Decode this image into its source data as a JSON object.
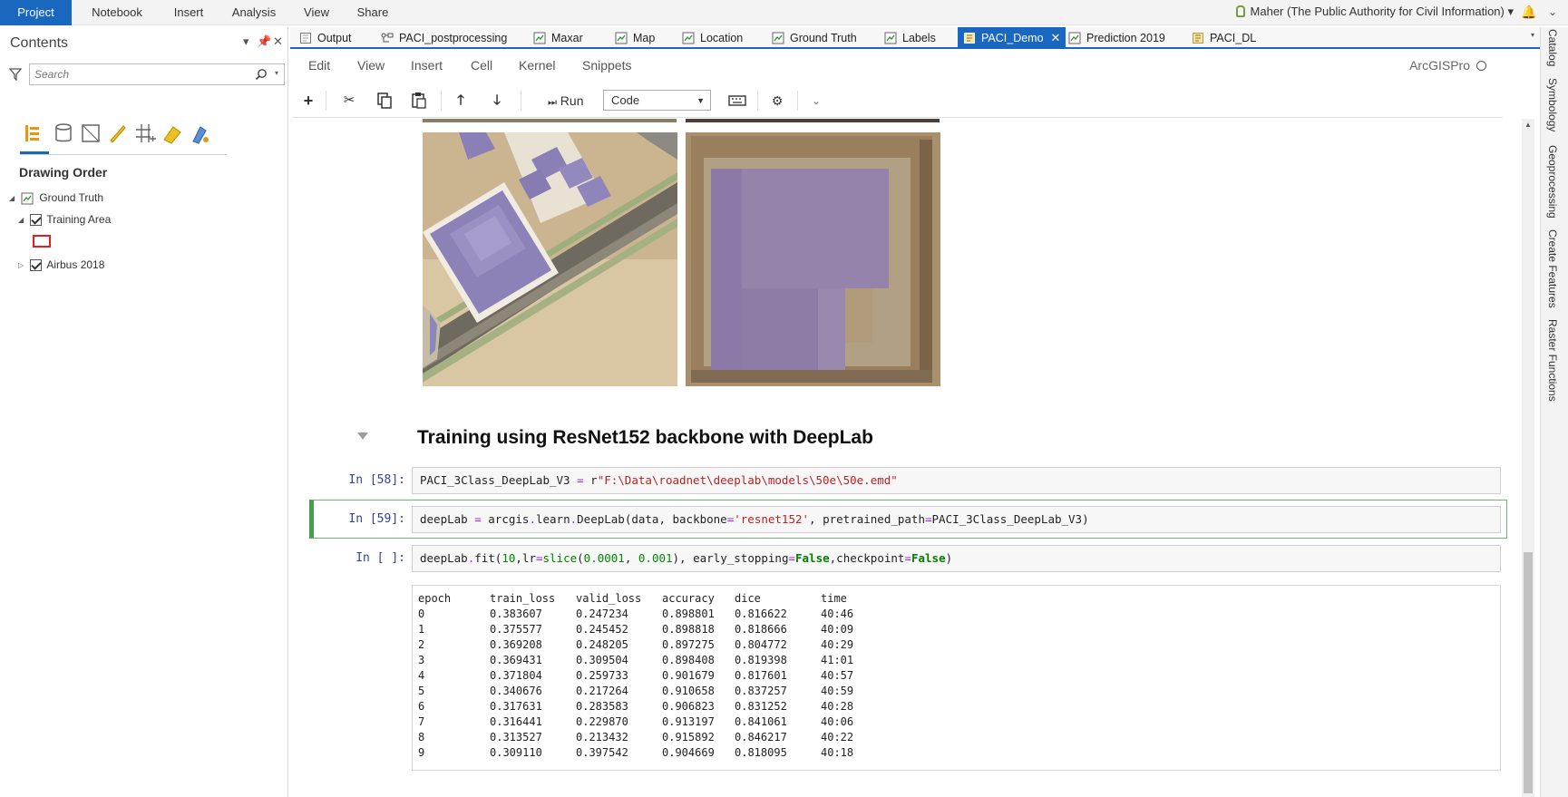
{
  "ribbon": {
    "tabs": [
      "Project",
      "Notebook",
      "Insert",
      "Analysis",
      "View",
      "Share"
    ],
    "user": "Maher (The Public Authority for Civil Information) ▾"
  },
  "contents": {
    "title": "Contents",
    "search_placeholder": "Search",
    "drawing_order": "Drawing Order",
    "tree": {
      "map": "Ground Truth",
      "layer1": "Training Area",
      "layer2": "Airbus 2018"
    }
  },
  "doc_tabs": [
    {
      "label": "Output",
      "icon": "notebook-icon"
    },
    {
      "label": "PACI_postprocessing",
      "icon": "model-icon"
    },
    {
      "label": "Maxar",
      "icon": "map-icon"
    },
    {
      "label": "Map",
      "icon": "map-icon"
    },
    {
      "label": "Location",
      "icon": "map-icon"
    },
    {
      "label": "Ground Truth",
      "icon": "map-icon"
    },
    {
      "label": "Labels",
      "icon": "map-icon"
    },
    {
      "label": "PACI_Demo",
      "icon": "notebook-icon",
      "active": true
    },
    {
      "label": "Prediction 2019",
      "icon": "map-icon"
    },
    {
      "label": "PACI_DL",
      "icon": "notebook-icon"
    }
  ],
  "nb_menu": [
    "Edit",
    "View",
    "Insert",
    "Cell",
    "Kernel",
    "Snippets"
  ],
  "kernel": "ArcGISPro",
  "toolbar": {
    "run": "Run",
    "cell_type": "Code"
  },
  "notebook": {
    "heading": "Training using ResNet152 backbone with DeepLab",
    "cells": [
      {
        "prompt": "In [58]:",
        "code": {
          "a": "PACI_3Class_DeepLab_V3 ",
          "b": "=",
          "c": " r",
          "d": "\"F:\\Data\\roadnet\\deeplab\\models\\50e\\50e.emd\""
        }
      },
      {
        "prompt": "In [59]:",
        "code": {
          "a": "deepLab ",
          "b": "=",
          "c": " arcgis",
          "d": ".",
          "e": "learn",
          "f": ".",
          "g": "DeepLab(data, backbone",
          "h": "=",
          "i": "'resnet152'",
          "j": ", pretrained_path",
          "k": "=",
          "l": "PACI_3Class_DeepLab_V3)"
        }
      },
      {
        "prompt": "In [ ]:",
        "code": {
          "a": "deepLab",
          "b": ".",
          "c": "fit(",
          "d": "10",
          "e": ",lr",
          "f": "=",
          "g": "slice",
          "h": "(",
          "i": "0.0001",
          "j": ", ",
          "k": "0.001",
          "l": "), early_stopping",
          "m": "=",
          "n": "False",
          "o": ",checkpoint",
          "p": "=",
          "q": "False",
          "r": ")"
        }
      }
    ],
    "output": {
      "columns": [
        "epoch",
        "train_loss",
        "valid_loss",
        "accuracy",
        "dice",
        "time"
      ],
      "rows": [
        [
          "0",
          "0.383607",
          "0.247234",
          "0.898801",
          "0.816622",
          "40:46"
        ],
        [
          "1",
          "0.375577",
          "0.245452",
          "0.898818",
          "0.818666",
          "40:09"
        ],
        [
          "2",
          "0.369208",
          "0.248205",
          "0.897275",
          "0.804772",
          "40:29"
        ],
        [
          "3",
          "0.369431",
          "0.309504",
          "0.898408",
          "0.819398",
          "41:01"
        ],
        [
          "4",
          "0.371804",
          "0.259733",
          "0.901679",
          "0.817601",
          "40:57"
        ],
        [
          "5",
          "0.340676",
          "0.217264",
          "0.910658",
          "0.837257",
          "40:59"
        ],
        [
          "6",
          "0.317631",
          "0.283583",
          "0.906823",
          "0.831252",
          "40:28"
        ],
        [
          "7",
          "0.316441",
          "0.229870",
          "0.913197",
          "0.841061",
          "40:06"
        ],
        [
          "8",
          "0.313527",
          "0.213432",
          "0.915892",
          "0.846217",
          "40:22"
        ],
        [
          "9",
          "0.309110",
          "0.397542",
          "0.904669",
          "0.818095",
          "40:18"
        ]
      ]
    }
  },
  "side_tabs": [
    "Catalog",
    "Symbology",
    "Geoprocessing",
    "Create Features",
    "Raster Functions"
  ],
  "colors": {
    "accent": "#1a67c0",
    "selected_cell": "#42a047",
    "prompt": "#303f9f"
  }
}
